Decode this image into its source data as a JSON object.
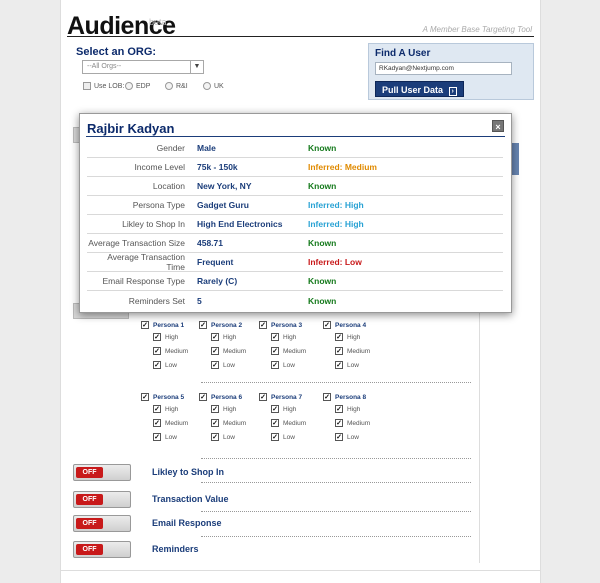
{
  "header": {
    "title": "Audience",
    "beta": "beta",
    "tagline": "A Member Base Targeting Tool"
  },
  "org": {
    "label": "Select an ORG:",
    "select_value": "--All Orgs--",
    "use_lob_label": "Use LOB:",
    "lob_options": [
      "EDP",
      "R&I",
      "UK"
    ]
  },
  "find_user": {
    "label": "Find A User",
    "input_value": "RKadyan@Nextjump.com",
    "button_label": "Pull User Data"
  },
  "modal": {
    "name": "Rajbir Kadyan",
    "close_label": "×",
    "rows": [
      {
        "label": "Gender",
        "value": "Male",
        "status": "Known"
      },
      {
        "label": "Income Level",
        "value": "75k - 150k",
        "status": "Inferred: Medium"
      },
      {
        "label": "Location",
        "value": "New York, NY",
        "status": "Known"
      },
      {
        "label": "Persona Type",
        "value": "Gadget Guru",
        "status": "Inferred: High"
      },
      {
        "label": "Likley to Shop In",
        "value": "High End Electronics",
        "status": "Inferred: High"
      },
      {
        "label": "Average Transaction Size",
        "value": "458.71",
        "status": "Known"
      },
      {
        "label": "Average Transaction Time",
        "value": "Frequent",
        "status": "Inferred: Low"
      },
      {
        "label": "Email Response Type",
        "value": "Rarely (C)",
        "status": "Known"
      },
      {
        "label": "Reminders Set",
        "value": "5",
        "status": "Known"
      }
    ],
    "status_colors": {
      "known": "#157a1c",
      "medium": "#e08a00",
      "high": "#29a2d4",
      "low": "#c8191a"
    }
  },
  "personas": {
    "levels": [
      "High",
      "Medium",
      "Low"
    ],
    "groups": [
      "Persona 1",
      "Persona 2",
      "Persona 3",
      "Persona 4",
      "Persona 5",
      "Persona 6",
      "Persona 7",
      "Persona 8"
    ]
  },
  "toggles": [
    {
      "state": "OFF",
      "label": "Likley to Shop In"
    },
    {
      "state": "OFF",
      "label": "Transaction Value"
    },
    {
      "state": "OFF",
      "label": "Email Response"
    },
    {
      "state": "OFF",
      "label": "Reminders"
    }
  ],
  "colors": {
    "brand_navy": "#1b3d7a",
    "off_red": "#c8191a"
  }
}
